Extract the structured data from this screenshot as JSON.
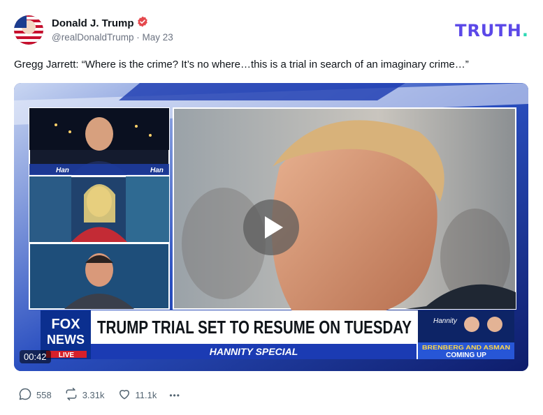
{
  "author": {
    "display_name": "Donald J. Trump",
    "handle": "@realDonaldTrump",
    "separator": "·",
    "date": "May 23"
  },
  "brand": {
    "logo_text": "TRUTH",
    "logo_dot": ".",
    "color": "#5b48e8",
    "dot_color": "#2fd9b4"
  },
  "post": {
    "text": "Gregg Jarrett: “Where is the crime? It’s no where…this is a trial in search of an imaginary crime…”"
  },
  "video": {
    "duration": "00:42",
    "headline": "TRUMP TRIAL SET TO RESUME ON TUESDAY",
    "show": "HANNITY SPECIAL",
    "network_top": "FOX",
    "network_bottom": "NEWS",
    "live": "LIVE",
    "promo_show": "Hannity",
    "promo_text_1": "BRENBERG AND ASMAN",
    "promo_text_2": "COMING UP",
    "panel_tag": "Han"
  },
  "actions": {
    "replies": "558",
    "retruths": "3.31k",
    "likes": "11.1k",
    "more": "•••"
  },
  "icons": {
    "verified": "verified-badge-icon",
    "reply": "speech-bubble-icon",
    "retruth": "repost-arrows-icon",
    "like": "heart-icon",
    "more": "ellipsis-icon",
    "play": "play-icon"
  }
}
